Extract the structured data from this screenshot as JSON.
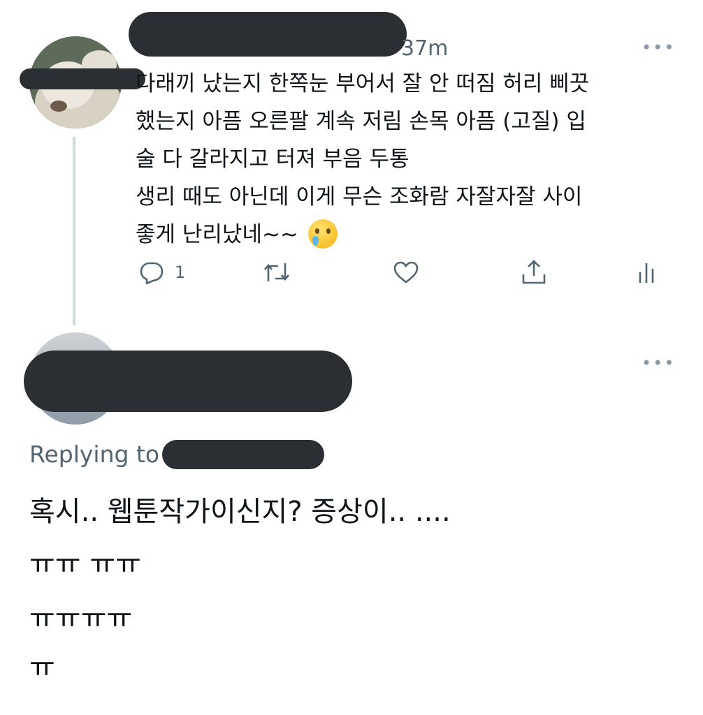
{
  "tweet1": {
    "timestamp": "37m",
    "text": "다래끼 났는지 한쪽눈 부어서 잘 안 떠짐 허리 삐끗\n했는지 아픔 오른팔 계속 저림 손목 아픔 (고질) 입\n술 다 갈라지고 터져 부음 두통\n생리 때도 아닌데 이게 무슨 조화람 자잘자잘 사이\n좋게 난리났네~~",
    "emoji": "face-holding-back-tears",
    "actions": {
      "reply_icon": "reply-icon",
      "reply_count": "1",
      "retweet_icon": "retweet-icon",
      "like_icon": "heart-icon",
      "share_icon": "share-icon",
      "analytics_icon": "analytics-icon"
    }
  },
  "tweet2": {
    "replying_to_label": "Replying to",
    "lines": [
      "혹시.. 웹툰작가이신지? 증상이.. ....",
      "ㅠㅠ ㅠㅠ",
      "ㅠㅠㅠㅠ",
      "ㅠ"
    ]
  },
  "colors": {
    "text": "#0f1419",
    "muted": "#536471",
    "redaction": "#2b2f33",
    "thread_line": "#cfd9de"
  }
}
